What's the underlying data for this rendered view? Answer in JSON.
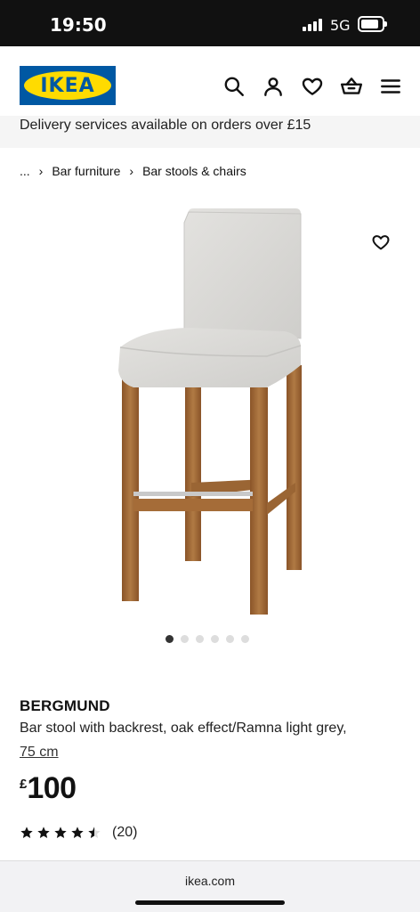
{
  "status_bar": {
    "time": "19:50",
    "network": "5G"
  },
  "header": {
    "logo_text": "IKEA"
  },
  "delivery_banner": {
    "text": "Delivery services available on orders over £15"
  },
  "breadcrumb": {
    "ellipsis": "...",
    "items": [
      "Bar furniture",
      "Bar stools & chairs"
    ]
  },
  "gallery": {
    "image_count": 6,
    "active_index": 0
  },
  "product": {
    "name": "BERGMUND",
    "description": "Bar stool with backrest, oak effect/Ramna light grey,",
    "size": "75 cm",
    "price_currency": "£",
    "price_value": "100",
    "rating": 4.5,
    "review_count": "(20)"
  },
  "browser": {
    "url": "ikea.com"
  },
  "colors": {
    "brand_blue": "#0058a3",
    "brand_yellow": "#ffdb00"
  }
}
